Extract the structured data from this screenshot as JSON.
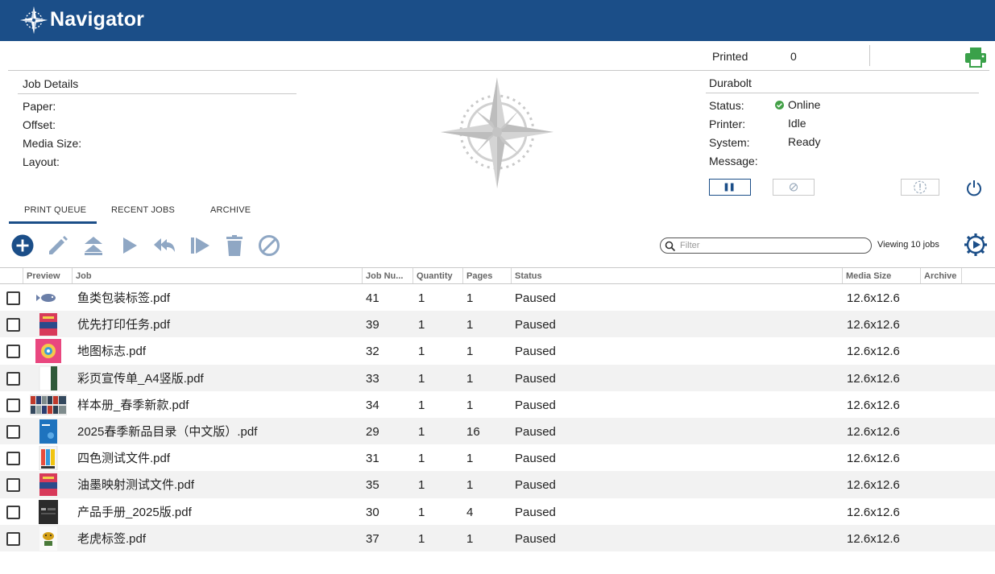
{
  "app": {
    "title": "Navigator",
    "icon": "compass-logo-icon"
  },
  "status_bar": {
    "printed_label": "Printed",
    "printed_value": "0",
    "print_icon": "printer-icon"
  },
  "job_details": {
    "title": "Job Details",
    "fields": [
      {
        "label": "Paper:",
        "value": ""
      },
      {
        "label": "Offset:",
        "value": ""
      },
      {
        "label": "Media Size:",
        "value": ""
      },
      {
        "label": "Layout:",
        "value": ""
      }
    ]
  },
  "printer": {
    "name": "Durabolt",
    "rows": [
      {
        "label": "Status:",
        "value": "Online"
      },
      {
        "label": "Printer:",
        "value": "Idle"
      },
      {
        "label": "System:",
        "value": "Ready"
      },
      {
        "label": "Message:",
        "value": ""
      }
    ],
    "online_color": "#43a047"
  },
  "tabs": [
    {
      "label": "PRINT QUEUE",
      "active": true
    },
    {
      "label": "RECENT JOBS",
      "active": false
    },
    {
      "label": "ARCHIVE",
      "active": false
    }
  ],
  "toolbar": {
    "icons": [
      "add-icon",
      "edit-icon",
      "move-to-top-icon",
      "play-icon",
      "reply-icon",
      "skip-icon",
      "delete-icon",
      "cancel-icon"
    ],
    "filter_placeholder": "Filter",
    "viewing_text": "Viewing 10 jobs"
  },
  "colors": {
    "brand": "#1b4e88",
    "toolbar_icon": "#8fa7c4",
    "accent_green": "#43a047"
  },
  "table": {
    "columns": [
      "Preview",
      "Job",
      "Job Nu...",
      "Quantity",
      "Pages",
      "Status",
      "Media Size",
      "Archive"
    ],
    "rows": [
      {
        "job": "鱼类包装标签.pdf",
        "job_number": "41",
        "quantity": "1",
        "pages": "1",
        "status": "Paused",
        "media_size": "12.6x12.6"
      },
      {
        "job": "优先打印任务.pdf",
        "job_number": "39",
        "quantity": "1",
        "pages": "1",
        "status": "Paused",
        "media_size": "12.6x12.6"
      },
      {
        "job": "地图标志.pdf",
        "job_number": "32",
        "quantity": "1",
        "pages": "1",
        "status": "Paused",
        "media_size": "12.6x12.6"
      },
      {
        "job": "彩页宣传单_A4竖版.pdf",
        "job_number": "33",
        "quantity": "1",
        "pages": "1",
        "status": "Paused",
        "media_size": "12.6x12.6"
      },
      {
        "job": "样本册_春季新款.pdf",
        "job_number": "34",
        "quantity": "1",
        "pages": "1",
        "status": "Paused",
        "media_size": "12.6x12.6"
      },
      {
        "job": "2025春季新品目录（中文版）.pdf",
        "job_number": "29",
        "quantity": "1",
        "pages": "16",
        "status": "Paused",
        "media_size": "12.6x12.6"
      },
      {
        "job": "四色测试文件.pdf",
        "job_number": "31",
        "quantity": "1",
        "pages": "1",
        "status": "Paused",
        "media_size": "12.6x12.6"
      },
      {
        "job": "油墨映射测试文件.pdf",
        "job_number": "35",
        "quantity": "1",
        "pages": "1",
        "status": "Paused",
        "media_size": "12.6x12.6"
      },
      {
        "job": "产品手册_2025版.pdf",
        "job_number": "30",
        "quantity": "1",
        "pages": "4",
        "status": "Paused",
        "media_size": "12.6x12.6"
      },
      {
        "job": "老虎标签.pdf",
        "job_number": "37",
        "quantity": "1",
        "pages": "1",
        "status": "Paused",
        "media_size": "12.6x12.6"
      }
    ]
  }
}
